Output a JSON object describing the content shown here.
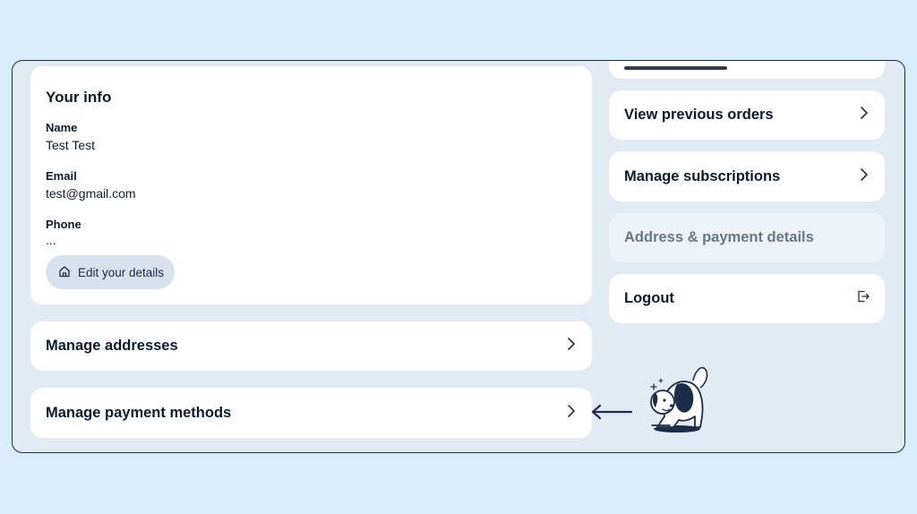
{
  "info": {
    "title": "Your info",
    "name_label": "Name",
    "name_value": "Test Test",
    "email_label": "Email",
    "email_value": "test@gmail.com",
    "phone_label": "Phone",
    "phone_value": "...",
    "edit_button": "Edit your details",
    "edit_icon": "home-icon"
  },
  "left_rows": [
    {
      "label": "Manage addresses",
      "icon": "chevron-right-icon"
    },
    {
      "label": "Manage payment methods",
      "icon": "chevron-right-icon"
    }
  ],
  "right_rows": [
    {
      "label": "View previous orders",
      "icon": "chevron-right-icon"
    },
    {
      "label": "Manage subscriptions",
      "icon": "chevron-right-icon"
    },
    {
      "label": "Address & payment details",
      "state": "active"
    },
    {
      "label": "Logout",
      "icon": "logout-icon"
    }
  ],
  "colors": {
    "page_bg": "#d7edfd",
    "frame_bg": "#e2eaf3",
    "accent": "#1c2d4a"
  }
}
